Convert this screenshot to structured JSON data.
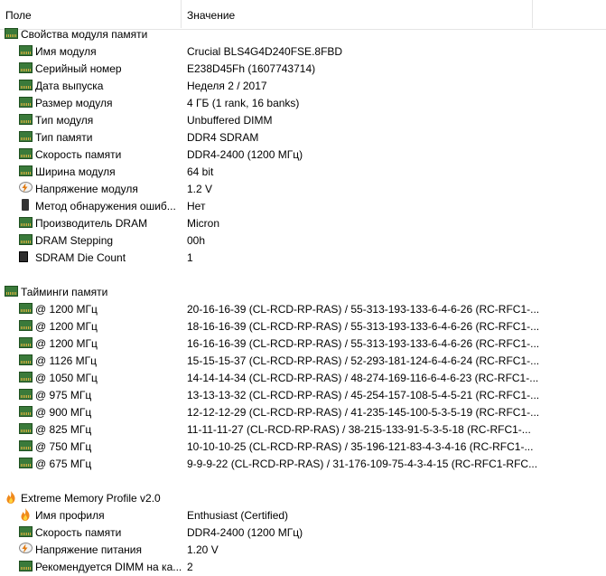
{
  "columns": {
    "field": "Поле",
    "value": "Значение"
  },
  "groups": [
    {
      "title": "Свойства модуля памяти",
      "icon": "ram-module-icon",
      "items": [
        {
          "label": "Имя модуля",
          "value": "Crucial BLS4G4D240FSE.8FBD",
          "icon": "ram-module-icon"
        },
        {
          "label": "Серийный номер",
          "value": "E238D45Fh (1607743714)",
          "icon": "ram-module-icon"
        },
        {
          "label": "Дата выпуска",
          "value": "Неделя 2 / 2017",
          "icon": "ram-module-icon"
        },
        {
          "label": "Размер модуля",
          "value": "4 ГБ (1 rank, 16 banks)",
          "icon": "ram-module-icon"
        },
        {
          "label": "Тип модуля",
          "value": "Unbuffered DIMM",
          "icon": "ram-module-icon"
        },
        {
          "label": "Тип памяти",
          "value": "DDR4 SDRAM",
          "icon": "ram-module-icon"
        },
        {
          "label": "Скорость памяти",
          "value": "DDR4-2400 (1200 МГц)",
          "icon": "ram-module-icon"
        },
        {
          "label": "Ширина модуля",
          "value": "64 bit",
          "icon": "ram-module-icon"
        },
        {
          "label": "Напряжение модуля",
          "value": "1.2 V",
          "icon": "voltage-icon"
        },
        {
          "label": "Метод обнаружения ошиб...",
          "value": "Нет",
          "icon": "device-icon"
        },
        {
          "label": "Производитель DRAM",
          "value": "Micron",
          "icon": "ram-module-icon"
        },
        {
          "label": "DRAM Stepping",
          "value": "00h",
          "icon": "ram-module-icon"
        },
        {
          "label": "SDRAM Die Count",
          "value": "1",
          "icon": "chip-icon"
        }
      ]
    },
    {
      "title": "Тайминги памяти",
      "icon": "ram-module-icon",
      "items": [
        {
          "label": "@ 1200 МГц",
          "value": "20-16-16-39  (CL-RCD-RP-RAS) / 55-313-193-133-6-4-6-26  (RC-RFC1-...",
          "icon": "ram-module-icon"
        },
        {
          "label": "@ 1200 МГц",
          "value": "18-16-16-39  (CL-RCD-RP-RAS) / 55-313-193-133-6-4-6-26  (RC-RFC1-...",
          "icon": "ram-module-icon"
        },
        {
          "label": "@ 1200 МГц",
          "value": "16-16-16-39  (CL-RCD-RP-RAS) / 55-313-193-133-6-4-6-26  (RC-RFC1-...",
          "icon": "ram-module-icon"
        },
        {
          "label": "@ 1126 МГц",
          "value": "15-15-15-37  (CL-RCD-RP-RAS) / 52-293-181-124-6-4-6-24  (RC-RFC1-...",
          "icon": "ram-module-icon"
        },
        {
          "label": "@ 1050 МГц",
          "value": "14-14-14-34  (CL-RCD-RP-RAS) / 48-274-169-116-6-4-6-23  (RC-RFC1-...",
          "icon": "ram-module-icon"
        },
        {
          "label": "@ 975 МГц",
          "value": "13-13-13-32  (CL-RCD-RP-RAS) / 45-254-157-108-5-4-5-21  (RC-RFC1-...",
          "icon": "ram-module-icon"
        },
        {
          "label": "@ 900 МГц",
          "value": "12-12-12-29  (CL-RCD-RP-RAS) / 41-235-145-100-5-3-5-19  (RC-RFC1-...",
          "icon": "ram-module-icon"
        },
        {
          "label": "@ 825 МГц",
          "value": "11-11-11-27  (CL-RCD-RP-RAS) / 38-215-133-91-5-3-5-18  (RC-RFC1-...",
          "icon": "ram-module-icon"
        },
        {
          "label": "@ 750 МГц",
          "value": "10-10-10-25  (CL-RCD-RP-RAS) / 35-196-121-83-4-3-4-16  (RC-RFC1-...",
          "icon": "ram-module-icon"
        },
        {
          "label": "@ 675 МГц",
          "value": "9-9-9-22  (CL-RCD-RP-RAS) / 31-176-109-75-4-3-4-15  (RC-RFC1-RFC...",
          "icon": "ram-module-icon"
        }
      ]
    },
    {
      "title": "Extreme Memory Profile v2.0",
      "icon": "flame-icon",
      "items": [
        {
          "label": "Имя профиля",
          "value": "Enthusiast (Certified)",
          "icon": "flame-icon"
        },
        {
          "label": "Скорость памяти",
          "value": "DDR4-2400 (1200 МГц)",
          "icon": "ram-module-icon"
        },
        {
          "label": "Напряжение питания",
          "value": "1.20 V",
          "icon": "voltage-icon"
        },
        {
          "label": "Рекомендуется DIMM на ка...",
          "value": "2",
          "icon": "ram-module-icon"
        }
      ]
    }
  ]
}
